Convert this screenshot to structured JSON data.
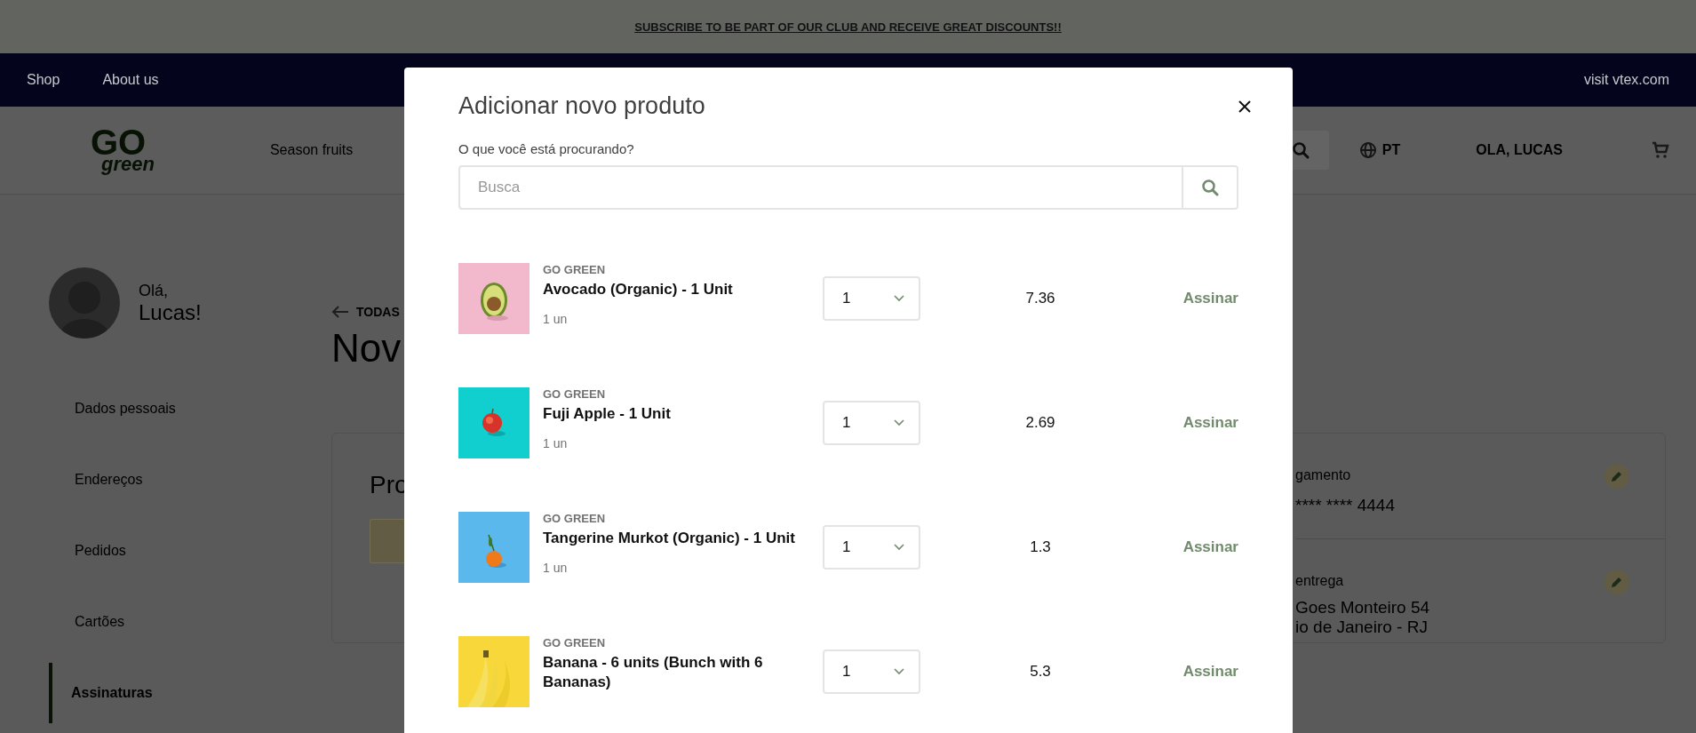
{
  "promo_banner": {
    "text": "SUBSCRIBE TO BE PART OF OUR CLUB AND RECEIVE GREAT DISCOUNTS!!"
  },
  "top_nav": {
    "links": [
      "Shop",
      "About us"
    ],
    "external_link": "visit vtex.com"
  },
  "header": {
    "logo": {
      "top": "GO",
      "bottom": "green"
    },
    "menu": [
      "Season fruits"
    ],
    "language": "PT",
    "greeting": "OLA, LUCAS"
  },
  "sidebar": {
    "greeting": "Olá,",
    "name": "Lucas!",
    "items": [
      {
        "label": "Dados pessoais",
        "selected": false
      },
      {
        "label": "Endereços",
        "selected": false
      },
      {
        "label": "Pedidos",
        "selected": false
      },
      {
        "label": "Cartões",
        "selected": false
      },
      {
        "label": "Assinaturas",
        "selected": true
      }
    ]
  },
  "main": {
    "back_link": "TODAS",
    "title": "Nov",
    "card": {
      "title": "Pro",
      "payment": {
        "label": "gamento",
        "value": "**** **** 4444"
      },
      "delivery": {
        "label": "entrega",
        "lines": [
          "Goes Monteiro 54",
          "io de Janeiro - RJ"
        ]
      }
    }
  },
  "modal": {
    "title": "Adicionar novo produto",
    "search_label": "O que você está procurando?",
    "search": {
      "placeholder": "Busca"
    },
    "products": [
      {
        "kind": "avocado",
        "brand": "GO GREEN",
        "name": "Avocado (Organic) - 1 Unit",
        "unit": "1 un",
        "quantity": "1",
        "price": "7.36",
        "action": "Assinar"
      },
      {
        "kind": "apple",
        "brand": "GO GREEN",
        "name": "Fuji Apple - 1 Unit",
        "unit": "1 un",
        "quantity": "1",
        "price": "2.69",
        "action": "Assinar"
      },
      {
        "kind": "tangerine",
        "brand": "GO GREEN",
        "name": "Tangerine Murkot (Organic) - 1 Unit",
        "unit": "1 un",
        "quantity": "1",
        "price": "1.3",
        "action": "Assinar"
      },
      {
        "kind": "banana",
        "brand": "GO GREEN",
        "name": "Banana - 6 units (Bunch with 6 Bananas)",
        "quantity": "1",
        "price": "5.3",
        "action": "Assinar"
      }
    ]
  }
}
